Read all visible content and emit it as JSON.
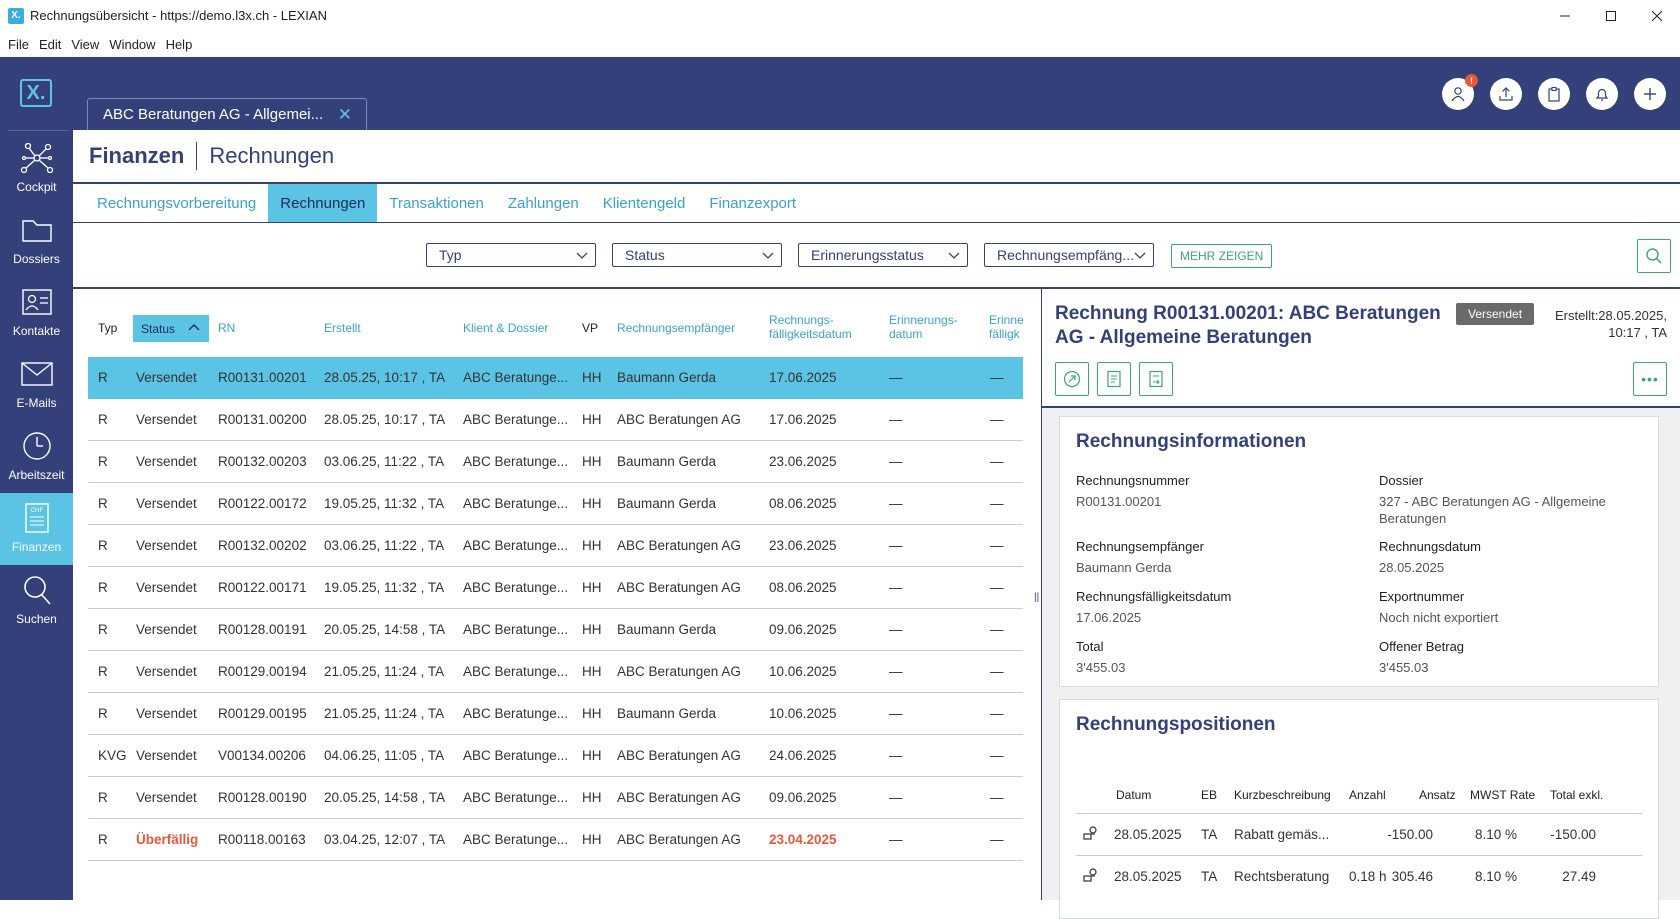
{
  "window": {
    "title": "Rechnungsübersicht - https://demo.l3x.ch - LEXIAN",
    "app_icon": "X."
  },
  "menu": [
    "File",
    "Edit",
    "View",
    "Window",
    "Help"
  ],
  "sidebar": {
    "logo": "X.",
    "items": [
      {
        "label": "Cockpit",
        "icon": "network-icon"
      },
      {
        "label": "Dossiers",
        "icon": "folder-icon"
      },
      {
        "label": "Kontakte",
        "icon": "contact-card-icon"
      },
      {
        "label": "E-Mails",
        "icon": "envelope-icon"
      },
      {
        "label": "Arbeitszeit",
        "icon": "clock-icon"
      },
      {
        "label": "Finanzen",
        "icon": "invoice-icon",
        "active": true
      },
      {
        "label": "Suchen",
        "icon": "search-icon"
      }
    ]
  },
  "doc_tab": {
    "label": "ABC Beratungen AG - Allgemei..."
  },
  "top_icons": {
    "badge": "!"
  },
  "breadcrumb": {
    "section": "Finanzen",
    "page": "Rechnungen"
  },
  "subtabs": [
    "Rechnungsvorbereitung",
    "Rechnungen",
    "Transaktionen",
    "Zahlungen",
    "Klientengeld",
    "Finanzexport"
  ],
  "filters": {
    "typ": "Typ",
    "status": "Status",
    "erinnerung": "Erinnerungsstatus",
    "empfaenger": "Rechnungsempfäng...",
    "more": "MEHR ZEIGEN"
  },
  "table": {
    "headers": {
      "typ": "Typ",
      "status": "Status",
      "rn": "RN",
      "erstellt": "Erstellt",
      "klient": "Klient & Dossier",
      "vp": "VP",
      "empfaenger": "Rechnungsempfänger",
      "faellig1": "Rechnungs-",
      "faellig2": "fälligkeitsdatum",
      "erinnerung1": "Erinnerungs-",
      "erinnerung2": "datum",
      "erinn1": "Erinne",
      "erinn2": "fälligk"
    },
    "rows": [
      {
        "typ": "R",
        "status": "Versendet",
        "rn": "R00131.00201",
        "erstellt": "28.05.25, 10:17 ,  TA",
        "klient": "ABC Beratunge...",
        "vp": "HH",
        "empfaenger": "Baumann Gerda",
        "faellig": "17.06.2025",
        "erinnerung": "—",
        "erinn": "—"
      },
      {
        "typ": "R",
        "status": "Versendet",
        "rn": "R00131.00200",
        "erstellt": "28.05.25, 10:17 ,  TA",
        "klient": "ABC Beratunge...",
        "vp": "HH",
        "empfaenger": "ABC Beratungen AG",
        "faellig": "17.06.2025",
        "erinnerung": "—",
        "erinn": "—"
      },
      {
        "typ": "R",
        "status": "Versendet",
        "rn": "R00132.00203",
        "erstellt": "03.06.25, 11:22 ,  TA",
        "klient": "ABC Beratunge...",
        "vp": "HH",
        "empfaenger": "Baumann Gerda",
        "faellig": "23.06.2025",
        "erinnerung": "—",
        "erinn": "—"
      },
      {
        "typ": "R",
        "status": "Versendet",
        "rn": "R00122.00172",
        "erstellt": "19.05.25, 11:32 ,  TA",
        "klient": "ABC Beratunge...",
        "vp": "HH",
        "empfaenger": "Baumann Gerda",
        "faellig": "08.06.2025",
        "erinnerung": "—",
        "erinn": "—"
      },
      {
        "typ": "R",
        "status": "Versendet",
        "rn": "R00132.00202",
        "erstellt": "03.06.25, 11:22 ,  TA",
        "klient": "ABC Beratunge...",
        "vp": "HH",
        "empfaenger": "ABC Beratungen AG",
        "faellig": "23.06.2025",
        "erinnerung": "—",
        "erinn": "—"
      },
      {
        "typ": "R",
        "status": "Versendet",
        "rn": "R00122.00171",
        "erstellt": "19.05.25, 11:32 ,  TA",
        "klient": "ABC Beratunge...",
        "vp": "HH",
        "empfaenger": "ABC Beratungen AG",
        "faellig": "08.06.2025",
        "erinnerung": "—",
        "erinn": "—"
      },
      {
        "typ": "R",
        "status": "Versendet",
        "rn": "R00128.00191",
        "erstellt": "20.05.25, 14:58 ,  TA",
        "klient": "ABC Beratunge...",
        "vp": "HH",
        "empfaenger": "Baumann Gerda",
        "faellig": "09.06.2025",
        "erinnerung": "—",
        "erinn": "—"
      },
      {
        "typ": "R",
        "status": "Versendet",
        "rn": "R00129.00194",
        "erstellt": "21.05.25, 11:24 ,  TA",
        "klient": "ABC Beratunge...",
        "vp": "HH",
        "empfaenger": "ABC Beratungen AG",
        "faellig": "10.06.2025",
        "erinnerung": "—",
        "erinn": "—"
      },
      {
        "typ": "R",
        "status": "Versendet",
        "rn": "R00129.00195",
        "erstellt": "21.05.25, 11:24 ,  TA",
        "klient": "ABC Beratunge...",
        "vp": "HH",
        "empfaenger": "Baumann Gerda",
        "faellig": "10.06.2025",
        "erinnerung": "—",
        "erinn": "—"
      },
      {
        "typ": "KVG",
        "status": "Versendet",
        "rn": "V00134.00206",
        "erstellt": "04.06.25, 11:05 ,  TA",
        "klient": "ABC Beratunge...",
        "vp": "HH",
        "empfaenger": "ABC Beratungen AG",
        "faellig": "24.06.2025",
        "erinnerung": "—",
        "erinn": "—"
      },
      {
        "typ": "R",
        "status": "Versendet",
        "rn": "R00128.00190",
        "erstellt": "20.05.25, 14:58 ,  TA",
        "klient": "ABC Beratunge...",
        "vp": "HH",
        "empfaenger": "ABC Beratungen AG",
        "faellig": "09.06.2025",
        "erinnerung": "—",
        "erinn": "—"
      },
      {
        "typ": "R",
        "status": "Überfällig",
        "rn": "R00118.00163",
        "erstellt": "03.04.25, 12:07 ,  TA",
        "klient": "ABC Beratunge...",
        "vp": "HH",
        "empfaenger": "ABC Beratungen AG",
        "faellig": "23.04.2025",
        "erinnerung": "—",
        "erinn": "—",
        "overdue": true
      }
    ]
  },
  "detail": {
    "title": "Rechnung R00131.00201: ABC Beratungen AG - Allgemeine Beratungen",
    "status": "Versendet",
    "created_line1": "Erstellt:28.05.2025,",
    "created_line2": "10:17 ,  TA",
    "info": {
      "heading": "Rechnungsinformationen",
      "rechnungsnummer_label": "Rechnungsnummer",
      "rechnungsnummer": "R00131.00201",
      "dossier_label": "Dossier",
      "dossier_line1": "327 - ABC Beratungen AG - Allgemeine",
      "dossier_line2": "Beratungen",
      "empfaenger_label": "Rechnungsempfänger",
      "empfaenger": "Baumann Gerda",
      "datum_label": "Rechnungsdatum",
      "datum": "28.05.2025",
      "faellig_label": "Rechnungsfälligkeitsdatum",
      "faellig": "17.06.2025",
      "export_label": "Exportnummer",
      "export": "Noch nicht exportiert",
      "total_label": "Total",
      "total": "3'455.03",
      "offen_label": "Offener Betrag",
      "offen": "3'455.03"
    },
    "positions": {
      "heading": "Rechnungspositionen",
      "headers": {
        "datum": "Datum",
        "eb": "EB",
        "kurz": "Kurzbeschreibung",
        "anzahl": "Anzahl",
        "ansatz": "Ansatz",
        "mwst": "MWST Rate",
        "total": "Total exkl."
      },
      "rows": [
        {
          "datum": "28.05.2025",
          "eb": "TA",
          "kurz": "Rabatt gemäs...",
          "anzahl": "",
          "ansatz": "-150.00",
          "mwst": "8.10 %",
          "total": "-150.00"
        },
        {
          "datum": "28.05.2025",
          "eb": "TA",
          "kurz": "Rechtsberatung",
          "anzahl": "0.18 h",
          "ansatz": "305.46",
          "mwst": "8.10 %",
          "total": "27.49"
        }
      ]
    }
  }
}
